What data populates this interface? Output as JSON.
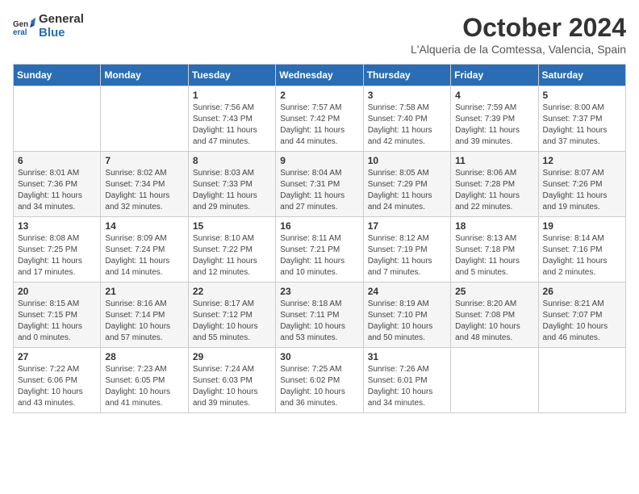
{
  "header": {
    "logo_line1": "General",
    "logo_line2": "Blue",
    "month": "October 2024",
    "location": "L'Alqueria de la Comtessa, Valencia, Spain"
  },
  "weekdays": [
    "Sunday",
    "Monday",
    "Tuesday",
    "Wednesday",
    "Thursday",
    "Friday",
    "Saturday"
  ],
  "weeks": [
    [
      {
        "day": "",
        "info": ""
      },
      {
        "day": "",
        "info": ""
      },
      {
        "day": "1",
        "info": "Sunrise: 7:56 AM\nSunset: 7:43 PM\nDaylight: 11 hours\nand 47 minutes."
      },
      {
        "day": "2",
        "info": "Sunrise: 7:57 AM\nSunset: 7:42 PM\nDaylight: 11 hours\nand 44 minutes."
      },
      {
        "day": "3",
        "info": "Sunrise: 7:58 AM\nSunset: 7:40 PM\nDaylight: 11 hours\nand 42 minutes."
      },
      {
        "day": "4",
        "info": "Sunrise: 7:59 AM\nSunset: 7:39 PM\nDaylight: 11 hours\nand 39 minutes."
      },
      {
        "day": "5",
        "info": "Sunrise: 8:00 AM\nSunset: 7:37 PM\nDaylight: 11 hours\nand 37 minutes."
      }
    ],
    [
      {
        "day": "6",
        "info": "Sunrise: 8:01 AM\nSunset: 7:36 PM\nDaylight: 11 hours\nand 34 minutes."
      },
      {
        "day": "7",
        "info": "Sunrise: 8:02 AM\nSunset: 7:34 PM\nDaylight: 11 hours\nand 32 minutes."
      },
      {
        "day": "8",
        "info": "Sunrise: 8:03 AM\nSunset: 7:33 PM\nDaylight: 11 hours\nand 29 minutes."
      },
      {
        "day": "9",
        "info": "Sunrise: 8:04 AM\nSunset: 7:31 PM\nDaylight: 11 hours\nand 27 minutes."
      },
      {
        "day": "10",
        "info": "Sunrise: 8:05 AM\nSunset: 7:29 PM\nDaylight: 11 hours\nand 24 minutes."
      },
      {
        "day": "11",
        "info": "Sunrise: 8:06 AM\nSunset: 7:28 PM\nDaylight: 11 hours\nand 22 minutes."
      },
      {
        "day": "12",
        "info": "Sunrise: 8:07 AM\nSunset: 7:26 PM\nDaylight: 11 hours\nand 19 minutes."
      }
    ],
    [
      {
        "day": "13",
        "info": "Sunrise: 8:08 AM\nSunset: 7:25 PM\nDaylight: 11 hours\nand 17 minutes."
      },
      {
        "day": "14",
        "info": "Sunrise: 8:09 AM\nSunset: 7:24 PM\nDaylight: 11 hours\nand 14 minutes."
      },
      {
        "day": "15",
        "info": "Sunrise: 8:10 AM\nSunset: 7:22 PM\nDaylight: 11 hours\nand 12 minutes."
      },
      {
        "day": "16",
        "info": "Sunrise: 8:11 AM\nSunset: 7:21 PM\nDaylight: 11 hours\nand 10 minutes."
      },
      {
        "day": "17",
        "info": "Sunrise: 8:12 AM\nSunset: 7:19 PM\nDaylight: 11 hours\nand 7 minutes."
      },
      {
        "day": "18",
        "info": "Sunrise: 8:13 AM\nSunset: 7:18 PM\nDaylight: 11 hours\nand 5 minutes."
      },
      {
        "day": "19",
        "info": "Sunrise: 8:14 AM\nSunset: 7:16 PM\nDaylight: 11 hours\nand 2 minutes."
      }
    ],
    [
      {
        "day": "20",
        "info": "Sunrise: 8:15 AM\nSunset: 7:15 PM\nDaylight: 11 hours\nand 0 minutes."
      },
      {
        "day": "21",
        "info": "Sunrise: 8:16 AM\nSunset: 7:14 PM\nDaylight: 10 hours\nand 57 minutes."
      },
      {
        "day": "22",
        "info": "Sunrise: 8:17 AM\nSunset: 7:12 PM\nDaylight: 10 hours\nand 55 minutes."
      },
      {
        "day": "23",
        "info": "Sunrise: 8:18 AM\nSunset: 7:11 PM\nDaylight: 10 hours\nand 53 minutes."
      },
      {
        "day": "24",
        "info": "Sunrise: 8:19 AM\nSunset: 7:10 PM\nDaylight: 10 hours\nand 50 minutes."
      },
      {
        "day": "25",
        "info": "Sunrise: 8:20 AM\nSunset: 7:08 PM\nDaylight: 10 hours\nand 48 minutes."
      },
      {
        "day": "26",
        "info": "Sunrise: 8:21 AM\nSunset: 7:07 PM\nDaylight: 10 hours\nand 46 minutes."
      }
    ],
    [
      {
        "day": "27",
        "info": "Sunrise: 7:22 AM\nSunset: 6:06 PM\nDaylight: 10 hours\nand 43 minutes."
      },
      {
        "day": "28",
        "info": "Sunrise: 7:23 AM\nSunset: 6:05 PM\nDaylight: 10 hours\nand 41 minutes."
      },
      {
        "day": "29",
        "info": "Sunrise: 7:24 AM\nSunset: 6:03 PM\nDaylight: 10 hours\nand 39 minutes."
      },
      {
        "day": "30",
        "info": "Sunrise: 7:25 AM\nSunset: 6:02 PM\nDaylight: 10 hours\nand 36 minutes."
      },
      {
        "day": "31",
        "info": "Sunrise: 7:26 AM\nSunset: 6:01 PM\nDaylight: 10 hours\nand 34 minutes."
      },
      {
        "day": "",
        "info": ""
      },
      {
        "day": "",
        "info": ""
      }
    ]
  ]
}
